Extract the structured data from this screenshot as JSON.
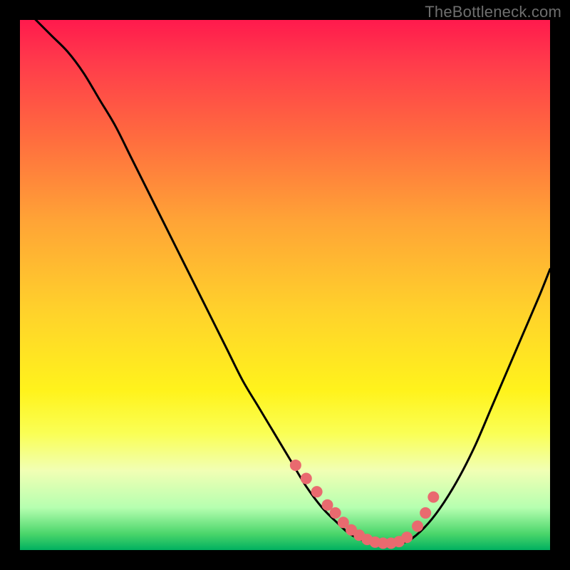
{
  "watermark": "TheBottleneck.com",
  "colors": {
    "curve": "#000000",
    "dot_fill": "#e96a6f",
    "dot_stroke": "#b24a4e"
  },
  "chart_data": {
    "type": "line",
    "title": "",
    "xlabel": "",
    "ylabel": "",
    "xlim": [
      0,
      100
    ],
    "ylim": [
      0,
      100
    ],
    "series": [
      {
        "name": "curve",
        "x": [
          0,
          3,
          6,
          9,
          12,
          15,
          18,
          21,
          24,
          27,
          30,
          33,
          36,
          39,
          42,
          45,
          48,
          51,
          54,
          57,
          60,
          62,
          64,
          66,
          68,
          70,
          72,
          74,
          77,
          80,
          83,
          86,
          89,
          92,
          95,
          98,
          100
        ],
        "y": [
          103,
          100,
          97,
          94,
          90,
          85,
          80,
          74,
          68,
          62,
          56,
          50,
          44,
          38,
          32,
          27,
          22,
          17,
          12,
          8,
          5,
          3.2,
          2.1,
          1.4,
          1.0,
          1.0,
          1.3,
          2.2,
          5,
          9,
          14,
          20,
          27,
          34,
          41,
          48,
          53
        ]
      }
    ],
    "dots": {
      "name": "dots",
      "radius_px": 8,
      "x": [
        52,
        54,
        56,
        58,
        59.5,
        61,
        62.5,
        64,
        65.5,
        67,
        68.5,
        70,
        71.5,
        73,
        75,
        76.5,
        78
      ],
      "y": [
        16,
        13.5,
        11,
        8.5,
        7,
        5.2,
        3.8,
        2.8,
        2.0,
        1.5,
        1.3,
        1.3,
        1.6,
        2.4,
        4.5,
        7,
        10
      ]
    }
  }
}
